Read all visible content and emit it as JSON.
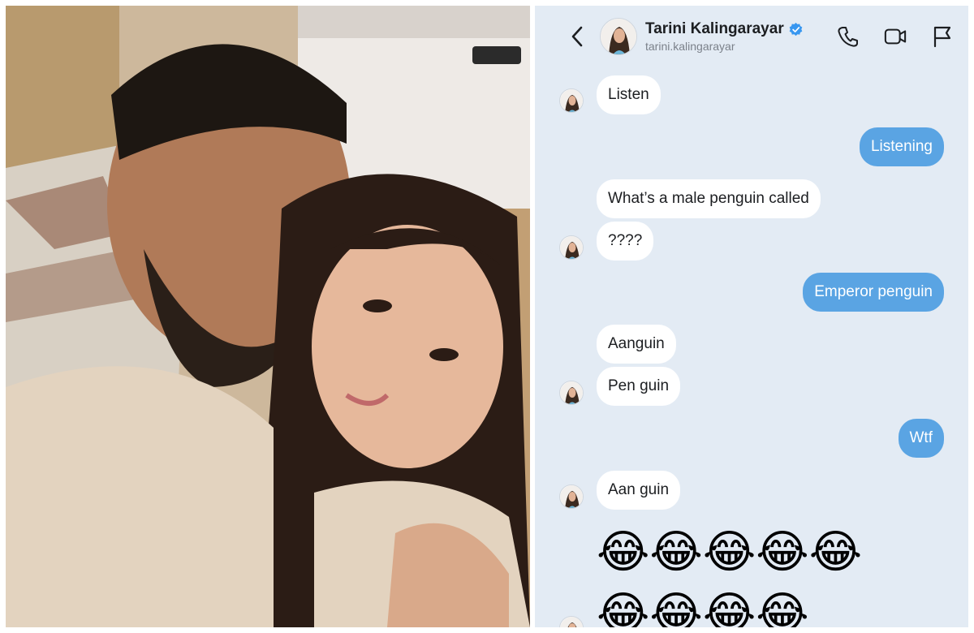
{
  "contact": {
    "name": "Tarini Kalingarayar",
    "handle": "tarini.kalingarayar",
    "verified": true
  },
  "header_icons": [
    "chevron-left-icon",
    "phone-icon",
    "video-camera-icon",
    "flag-icon"
  ],
  "colors": {
    "chat_background": "#e3ebf4",
    "incoming_bubble": "#ffffff",
    "outgoing_bubble": "#5aa4e3",
    "verified_badge": "#3897f0"
  },
  "messages": [
    {
      "from": "them",
      "text": "Listen"
    },
    {
      "from": "me",
      "text": "Listening"
    },
    {
      "from": "them",
      "text": "What’s a male penguin called"
    },
    {
      "from": "them",
      "text": "????"
    },
    {
      "from": "me",
      "text": "Emperor penguin"
    },
    {
      "from": "them",
      "text": "Aanguin"
    },
    {
      "from": "them",
      "text": "Pen guin"
    },
    {
      "from": "me",
      "text": "Wtf"
    },
    {
      "from": "them",
      "text": "Aan guin"
    }
  ],
  "emoji_rows": [
    "😂😂😂😂😂",
    "😂😂😂😂"
  ]
}
